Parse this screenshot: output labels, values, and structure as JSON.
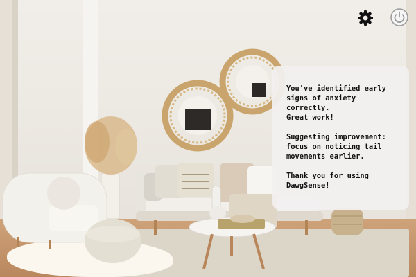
{
  "toolbar": {
    "settings_icon": "gear-icon",
    "power_icon": "power-icon"
  },
  "feedback": {
    "line1": "You've identified early\nsigns of anxiety correctly.\nGreat work!",
    "line2": "Suggesting improvement:\nfocus on noticing tail\nmovements earlier.",
    "line3": "Thank you for using\nDawgSense!"
  },
  "colors": {
    "dialog_bg": "#f2f0f0",
    "text": "#111111",
    "icon_dark": "#111111",
    "icon_grey": "#9a9a9a"
  }
}
